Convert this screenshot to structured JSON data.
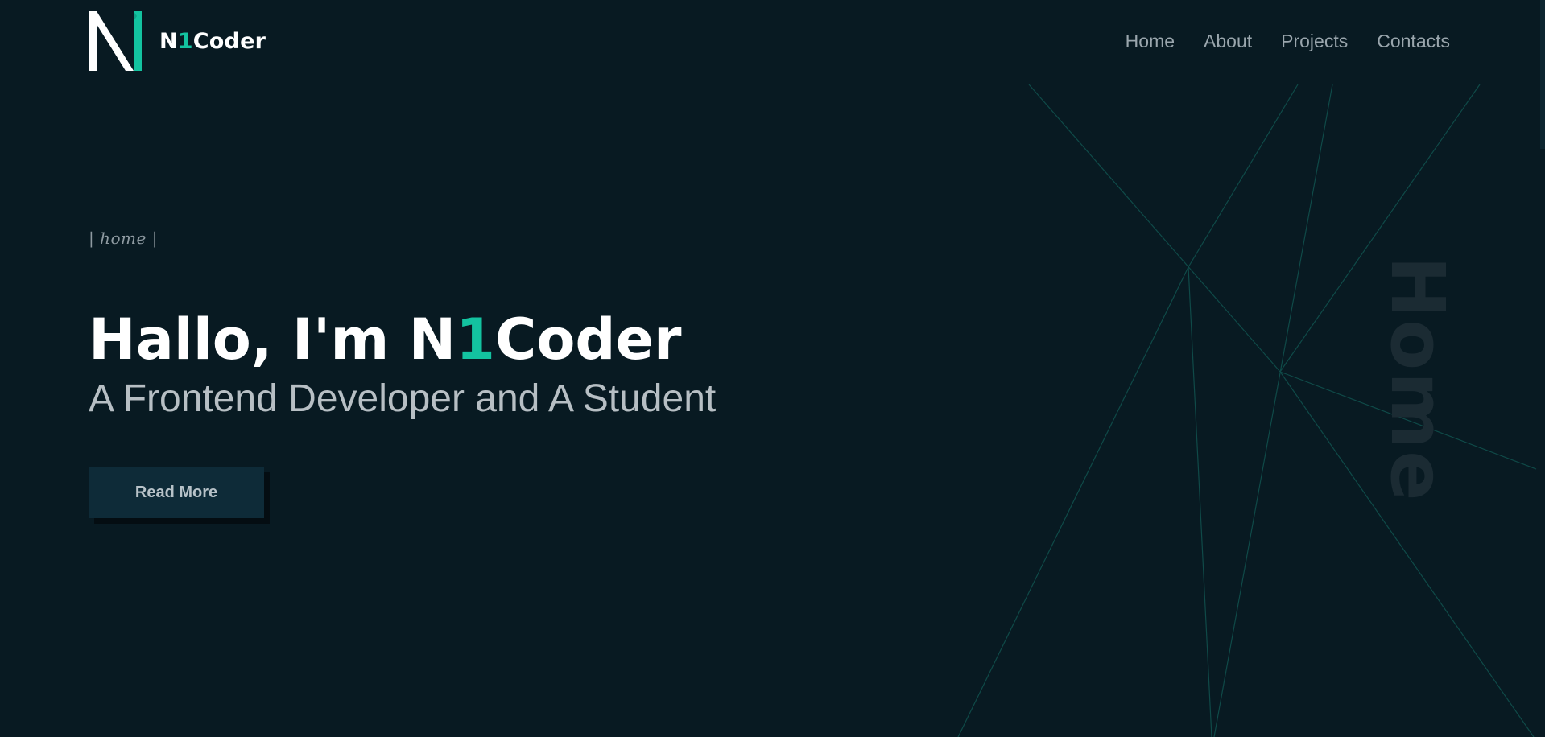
{
  "header": {
    "logo": {
      "prefix": "N",
      "accent": "1",
      "suffix": "Coder"
    },
    "nav": [
      {
        "label": "Home"
      },
      {
        "label": "About"
      },
      {
        "label": "Projects"
      },
      {
        "label": "Contacts"
      }
    ]
  },
  "hero": {
    "breadcrumb": "home",
    "title_prefix": "Hallo, I'm N",
    "title_accent": "1",
    "title_suffix": "Coder",
    "subtitle": "A Frontend Developer and A Student",
    "button_label": "Read More"
  },
  "watermark": "Home",
  "colors": {
    "background": "#081a22",
    "accent": "#13c3a0",
    "nav_text": "#9aa6ad",
    "button_bg": "#0e2b38",
    "line": "#0f4a48"
  }
}
